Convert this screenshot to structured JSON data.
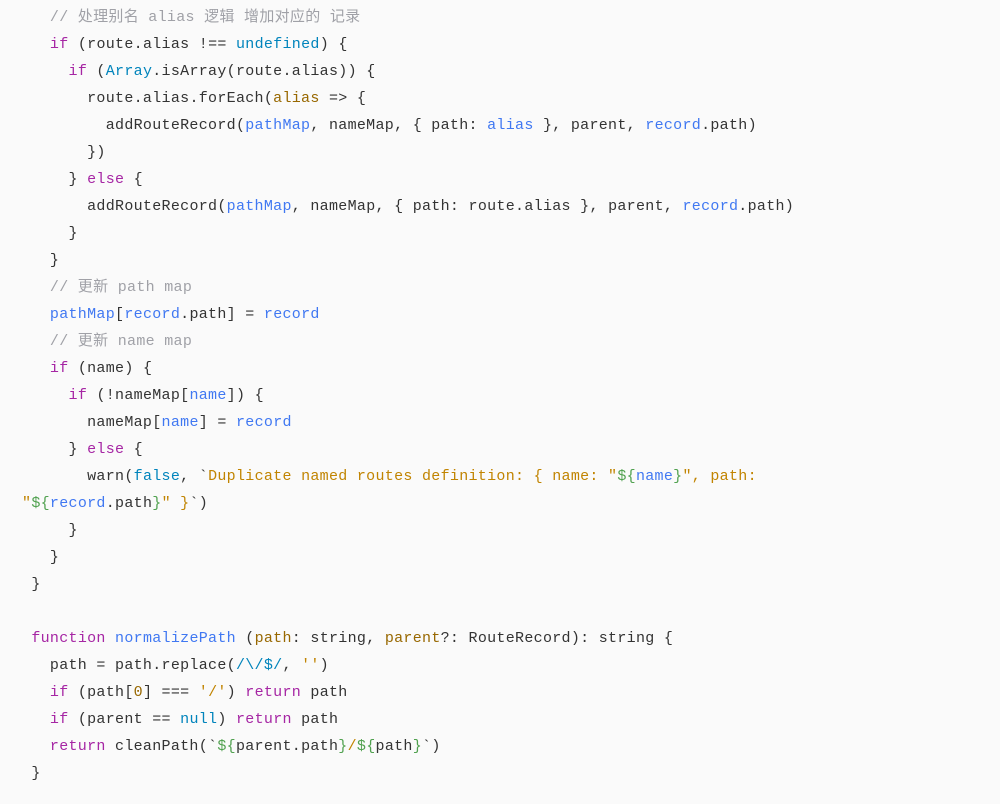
{
  "code": {
    "comment_alias": "// 处理别名 alias 逻辑 增加对应的 记录",
    "kw_if": "if",
    "kw_else": "else",
    "kw_function": "function",
    "kw_return": "return",
    "ident_route": "route",
    "ident_alias": ".alias",
    "op_neq": " !== ",
    "lit_undefined": "undefined",
    "pun_paren_open": "(",
    "pun_paren_close": ")",
    "pun_brace_open": " {",
    "pun_brace_close": "}",
    "ident_Array": "Array",
    "ident_isArray": ".isArray(",
    "ident_route_alias": "route.alias",
    "ident_forEach": "route.alias.forEach(",
    "param_alias": "alias",
    "arrow": " => {",
    "fn_addRouteRecord": "addRouteRecord(",
    "param_pathMap": "pathMap",
    "ident_nameMap": ", nameMap, { ",
    "ident_path_key": "path",
    "colon_space": ": ",
    "ident_alias_ref": "alias",
    "ident_route_alias_inline": "route.alias",
    "close_obj_parent": " }, parent, ",
    "ident_record": "record",
    "dot_path": ".path)",
    "close_foreach": "})",
    "comment_pathmap": "// 更新 path map",
    "ident_pathMap": "pathMap",
    "bracket_open": "[",
    "ident_record_path": "record",
    "dot_path_only": ".path",
    "bracket_close_eq": "] = ",
    "ident_record2": "record",
    "comment_namemap": "// 更新 name map",
    "ident_name": "name",
    "not_nameMap": "(!nameMap[",
    "ident_name2": "name",
    "close_bracket_paren": "]) {",
    "nameMap_assign": "nameMap[",
    "close_assign": "] = ",
    "fn_warn": "warn(",
    "lit_false": "false",
    "comma_tick": ", `",
    "str_warn1": "Duplicate named routes definition: { name: \"",
    "tmpl_open": "${",
    "tmpl_name": "name",
    "tmpl_close": "}",
    "str_warn2": "\", path: ",
    "str_warn3": "\"",
    "tmpl_record": "record",
    "tmpl_dot_path": ".path",
    "str_warn4": "\" }",
    "tick_close": "`)",
    "fn_normalizePath": "normalizePath",
    "sig_open": " (",
    "param_path": "path",
    "type_string": ": string, ",
    "param_parent": "parent",
    "type_opt_rr": "?: RouteRecord): string {",
    "assign_path": "path = path.replace(",
    "regex": "/\\/$/",
    "comma_q": ", ",
    "str_empty": "''",
    "close_paren": ")",
    "path_idx": "(path[",
    "num_zero": "0",
    "close_idx_eq": "] === ",
    "str_slash": "'/'",
    "return_path": " path",
    "parent_eq_null": "(parent == ",
    "lit_null": "null",
    "return_clean": " cleanPath(`",
    "tmpl_parent_path": "parent.path",
    "str_slash_mid": "/",
    "tmpl_path": "path",
    "close_tick_paren": "`)"
  }
}
